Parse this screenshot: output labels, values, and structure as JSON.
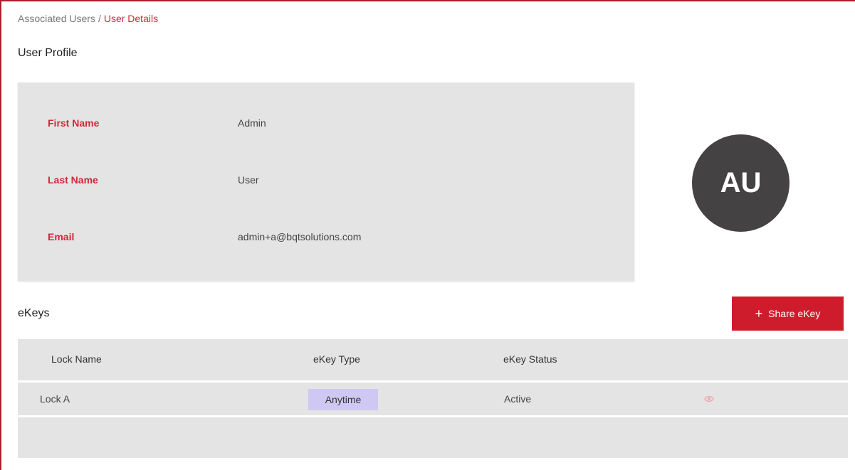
{
  "breadcrumb": {
    "parent": "Associated Users",
    "separator": "/",
    "current": "User Details"
  },
  "profile": {
    "section_title": "User Profile",
    "fields": [
      {
        "label": "First Name",
        "value": "Admin"
      },
      {
        "label": "Last Name",
        "value": "User"
      },
      {
        "label": "Email",
        "value": "admin+a@bqtsolutions.com"
      }
    ],
    "avatar_initials": "AU"
  },
  "ekeys": {
    "section_title": "eKeys",
    "share_button": {
      "icon": "plus-icon",
      "label": "Share eKey"
    },
    "columns": [
      "Lock Name",
      "eKey Type",
      "eKey Status"
    ],
    "rows": [
      {
        "lock_name": "Lock A",
        "ekey_type": "Anytime",
        "ekey_status": "Active",
        "action_icon": "eye-icon"
      }
    ]
  },
  "colors": {
    "accent": "#cf1c2d",
    "label_red": "#d0283a",
    "card_bg": "#e4e4e4",
    "avatar_bg": "#444242",
    "badge_bg": "#cfc8f2"
  }
}
